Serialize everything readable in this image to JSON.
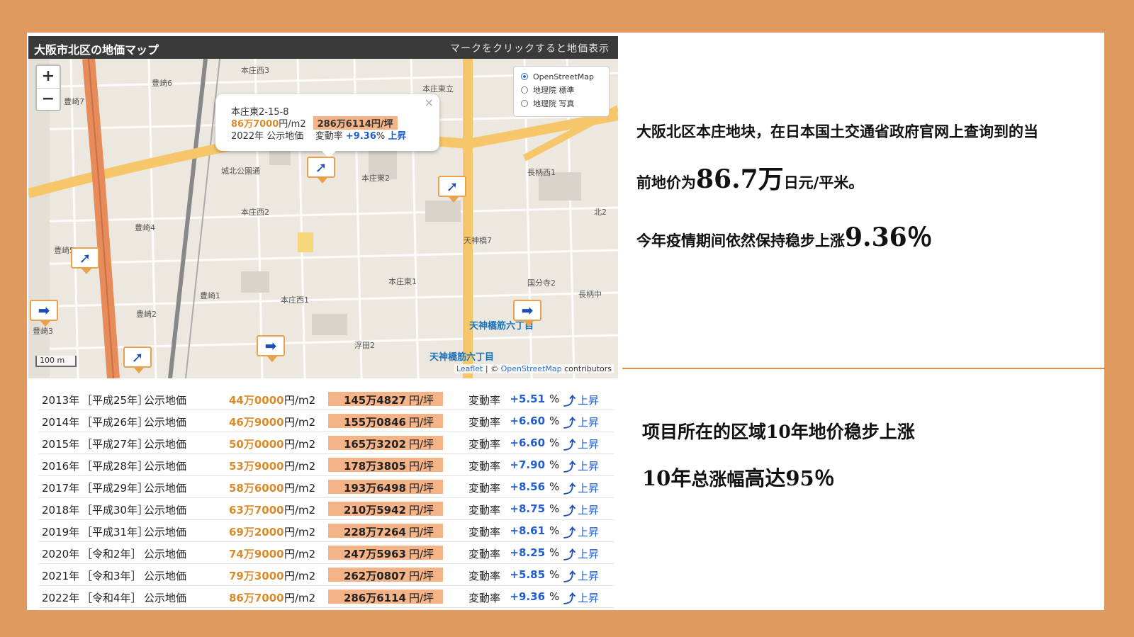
{
  "map": {
    "title": "大阪市北区の地価マップ",
    "hint": "マークをクリックすると地価表示",
    "zoom_in": "+",
    "zoom_out": "−",
    "layers": [
      "OpenStreetMap",
      "地理院 標準",
      "地理院 写真"
    ],
    "popup": {
      "address": "本庄東2-15-8",
      "price_sqm": "86万7000",
      "unit_sqm": "円/m2",
      "price_tsubo": "286万6114円/坪",
      "label": "2022年 公示地価",
      "change_label": "変動率",
      "change_value": "+9.36",
      "change_pct": "%",
      "change_dir": "上昇",
      "close": "×"
    },
    "streets": {
      "s1": "本庄西3",
      "s2": "豊崎6",
      "s3": "豊崎7",
      "s4": "本庄東2",
      "s5": "本庄西2",
      "s6": "豊崎4",
      "s7": "豊崎5",
      "s8": "豊崎1",
      "s9": "豊崎2",
      "s10": "豊崎3",
      "s11": "本庄西1",
      "s12": "本庄東1",
      "s13": "浮田2",
      "s14": "天神橋7",
      "s15": "国分寺2",
      "s16": "長柄中",
      "s17": "長柄西1",
      "s18": "城北公園通",
      "s19": "北2",
      "s20": "本庄東立"
    },
    "stations": {
      "st1": "天神橋筋六丁目",
      "st2": "天神橋筋六丁目"
    },
    "scale": "100 m",
    "attribution_leaflet": "Leaflet",
    "attribution_sep": " | © ",
    "attribution_osm": "OpenStreetMap",
    "attribution_rest": " contributors"
  },
  "table": {
    "rows": [
      {
        "year": "2013年",
        "era": "［平成25年］",
        "type": "公示地価",
        "price": "44万0000",
        "unit": "円/m2",
        "tsubo": "145万4827",
        "tsubo_unit": "円/坪",
        "label": "変動率",
        "rate": "+5.51",
        "pct": "%",
        "dir": "上昇"
      },
      {
        "year": "2014年",
        "era": "［平成26年］",
        "type": "公示地価",
        "price": "46万9000",
        "unit": "円/m2",
        "tsubo": "155万0846",
        "tsubo_unit": "円/坪",
        "label": "変動率",
        "rate": "+6.60",
        "pct": "%",
        "dir": "上昇"
      },
      {
        "year": "2015年",
        "era": "［平成27年］",
        "type": "公示地価",
        "price": "50万0000",
        "unit": "円/m2",
        "tsubo": "165万3202",
        "tsubo_unit": "円/坪",
        "label": "変動率",
        "rate": "+6.60",
        "pct": "%",
        "dir": "上昇"
      },
      {
        "year": "2016年",
        "era": "［平成28年］",
        "type": "公示地価",
        "price": "53万9000",
        "unit": "円/m2",
        "tsubo": "178万3805",
        "tsubo_unit": "円/坪",
        "label": "変動率",
        "rate": "+7.90",
        "pct": "%",
        "dir": "上昇"
      },
      {
        "year": "2017年",
        "era": "［平成29年］",
        "type": "公示地価",
        "price": "58万6000",
        "unit": "円/m2",
        "tsubo": "193万6498",
        "tsubo_unit": "円/坪",
        "label": "変動率",
        "rate": "+8.56",
        "pct": "%",
        "dir": "上昇"
      },
      {
        "year": "2018年",
        "era": "［平成30年］",
        "type": "公示地価",
        "price": "63万7000",
        "unit": "円/m2",
        "tsubo": "210万5942",
        "tsubo_unit": "円/坪",
        "label": "変動率",
        "rate": "+8.75",
        "pct": "%",
        "dir": "上昇"
      },
      {
        "year": "2019年",
        "era": "［平成31年］",
        "type": "公示地価",
        "price": "69万2000",
        "unit": "円/m2",
        "tsubo": "228万7264",
        "tsubo_unit": "円/坪",
        "label": "変動率",
        "rate": "+8.61",
        "pct": "%",
        "dir": "上昇"
      },
      {
        "year": "2020年",
        "era": "［令和2年］",
        "type": "公示地価",
        "price": "74万9000",
        "unit": "円/m2",
        "tsubo": "247万5963",
        "tsubo_unit": "円/坪",
        "label": "変動率",
        "rate": "+8.25",
        "pct": "%",
        "dir": "上昇"
      },
      {
        "year": "2021年",
        "era": "［令和3年］",
        "type": "公示地価",
        "price": "79万3000",
        "unit": "円/m2",
        "tsubo": "262万0807",
        "tsubo_unit": "円/坪",
        "label": "変動率",
        "rate": "+5.85",
        "pct": "%",
        "dir": "上昇"
      },
      {
        "year": "2022年",
        "era": "［令和4年］",
        "type": "公示地価",
        "price": "86万7000",
        "unit": "円/m2",
        "tsubo": "286万6114",
        "tsubo_unit": "円/坪",
        "label": "変動率",
        "rate": "+9.36",
        "pct": "%",
        "dir": "上昇"
      }
    ]
  },
  "text": {
    "line1": "大阪北区本庄地块，在日本国土交通省政府官网上查询到的当",
    "line2_pre": "前地价为",
    "line2_big": "86.7万",
    "line2_post": "日元/平米。",
    "line3_pre": "今年疫情期间依然保持稳步上涨",
    "line3_big": "9.36％",
    "line4": "项目所在的区域10年地价稳步上涨",
    "line5_pre": "10年",
    "line5_mid": "总涨幅",
    "line5_post": "高达95％"
  },
  "colors": {
    "accent": "#e09a5f",
    "price_highlight": "#f5b488",
    "rate_blue": "#1f5fd1"
  },
  "icons": {
    "marker": "up-right-arrow-icon",
    "rate": "up-arrow-icon"
  }
}
